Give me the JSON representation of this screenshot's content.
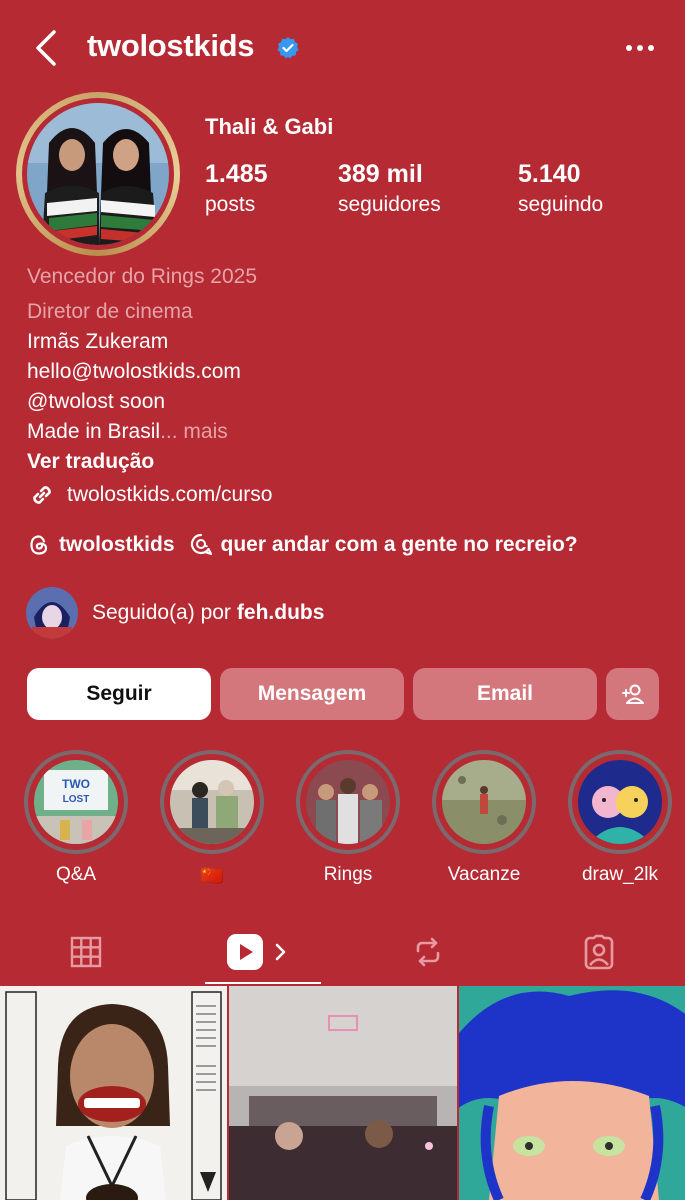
{
  "header": {
    "username": "twolostkids",
    "back_icon": "chevron-left-icon",
    "verified_icon": "verified-badge-icon",
    "more_icon": "more-horizontal-icon"
  },
  "profile": {
    "name": "Thali & Gabi",
    "stats": [
      {
        "value": "1.485",
        "label": "posts"
      },
      {
        "value": "389 mil",
        "label": "seguidores"
      },
      {
        "value": "5.140",
        "label": "seguindo"
      }
    ],
    "bio": {
      "award": "Vencedor do Rings 2025",
      "category": "Diretor de cinema",
      "lines": [
        "Irmãs Zukeram",
        "hello@twolostkids.com",
        "@twolost soon"
      ],
      "last_line": "Made in Brasil",
      "ellipsis": "...",
      "more": " mais",
      "translate": "Ver tradução",
      "link": "twolostkids.com/curso"
    },
    "threads": {
      "handle": "twolostkids",
      "note": "quer andar com a gente no recreio?"
    },
    "followed_by": {
      "prefix": "Seguido(a) por ",
      "user": "feh.dubs"
    }
  },
  "actions": {
    "follow": "Seguir",
    "message": "Mensagem",
    "email": "Email",
    "add_icon": "add-person-icon"
  },
  "highlights": [
    {
      "label": "Q&A"
    },
    {
      "label": "🇨🇳"
    },
    {
      "label": "Rings"
    },
    {
      "label": "Vacanze"
    },
    {
      "label": "draw_2lk"
    }
  ],
  "colors": {
    "background": "#b52a33",
    "button_muted": "#d4777d",
    "verified": "#3897f0"
  }
}
